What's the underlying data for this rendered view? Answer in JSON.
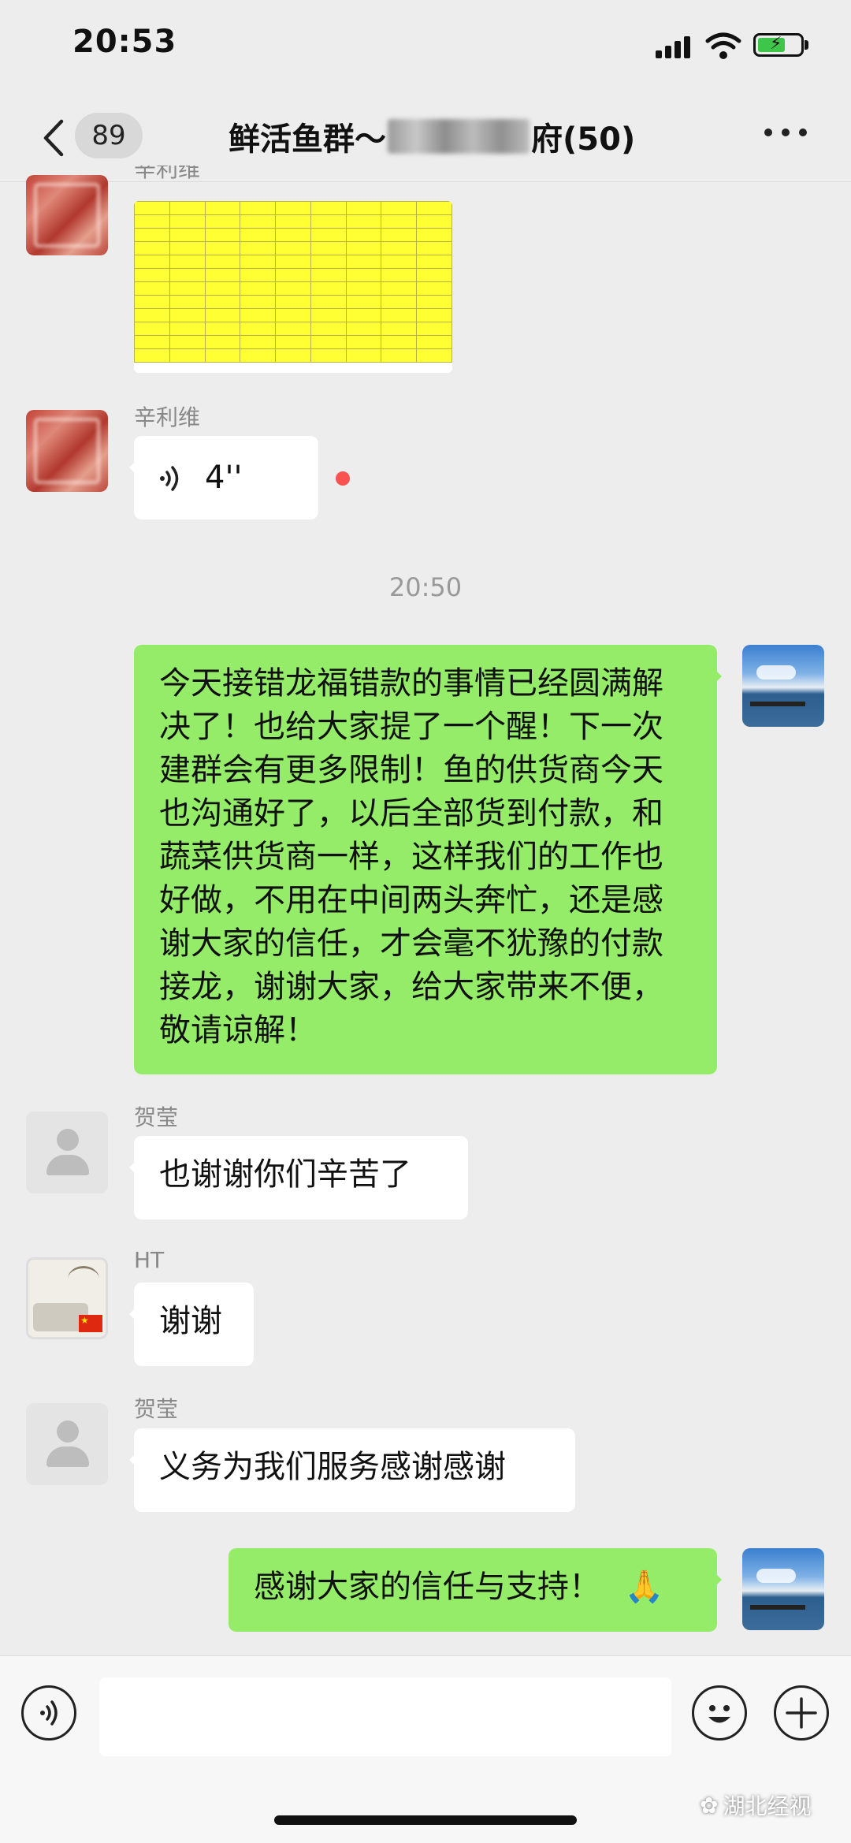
{
  "status_bar": {
    "time": "20:53"
  },
  "nav": {
    "unread_count": "89",
    "title_prefix": "鲜活鱼群～",
    "title_suffix": "府(50)"
  },
  "messages": {
    "m1": {
      "sender": "辛利维"
    },
    "m2": {
      "sender": "辛利维",
      "voice_duration": "4''"
    },
    "time_divider": "20:50",
    "m3": {
      "text": "今天接错龙福错款的事情已经圆满解决了！也给大家提了一个醒！下一次建群会有更多限制！鱼的供货商今天也沟通好了，以后全部货到付款，和蔬菜供货商一样，这样我们的工作也好做，不用在中间两头奔忙，还是感谢大家的信任，才会毫不犹豫的付款接龙，谢谢大家，给大家带来不便，敬请谅解！"
    },
    "m4": {
      "sender": "贺莹",
      "text": "也谢谢你们辛苦了"
    },
    "m5": {
      "sender": "HT",
      "text": "谢谢"
    },
    "m6": {
      "sender": "贺莹",
      "text": "义务为我们服务感谢感谢"
    },
    "m7": {
      "text": "感谢大家的信任与支持！",
      "emoji": "🙏"
    }
  },
  "watermark": {
    "text": "湖北经视"
  },
  "colors": {
    "self_bubble": "#95ec69",
    "other_bubble": "#ffffff",
    "background": "#ededed",
    "unread_dot": "#fa5151"
  }
}
